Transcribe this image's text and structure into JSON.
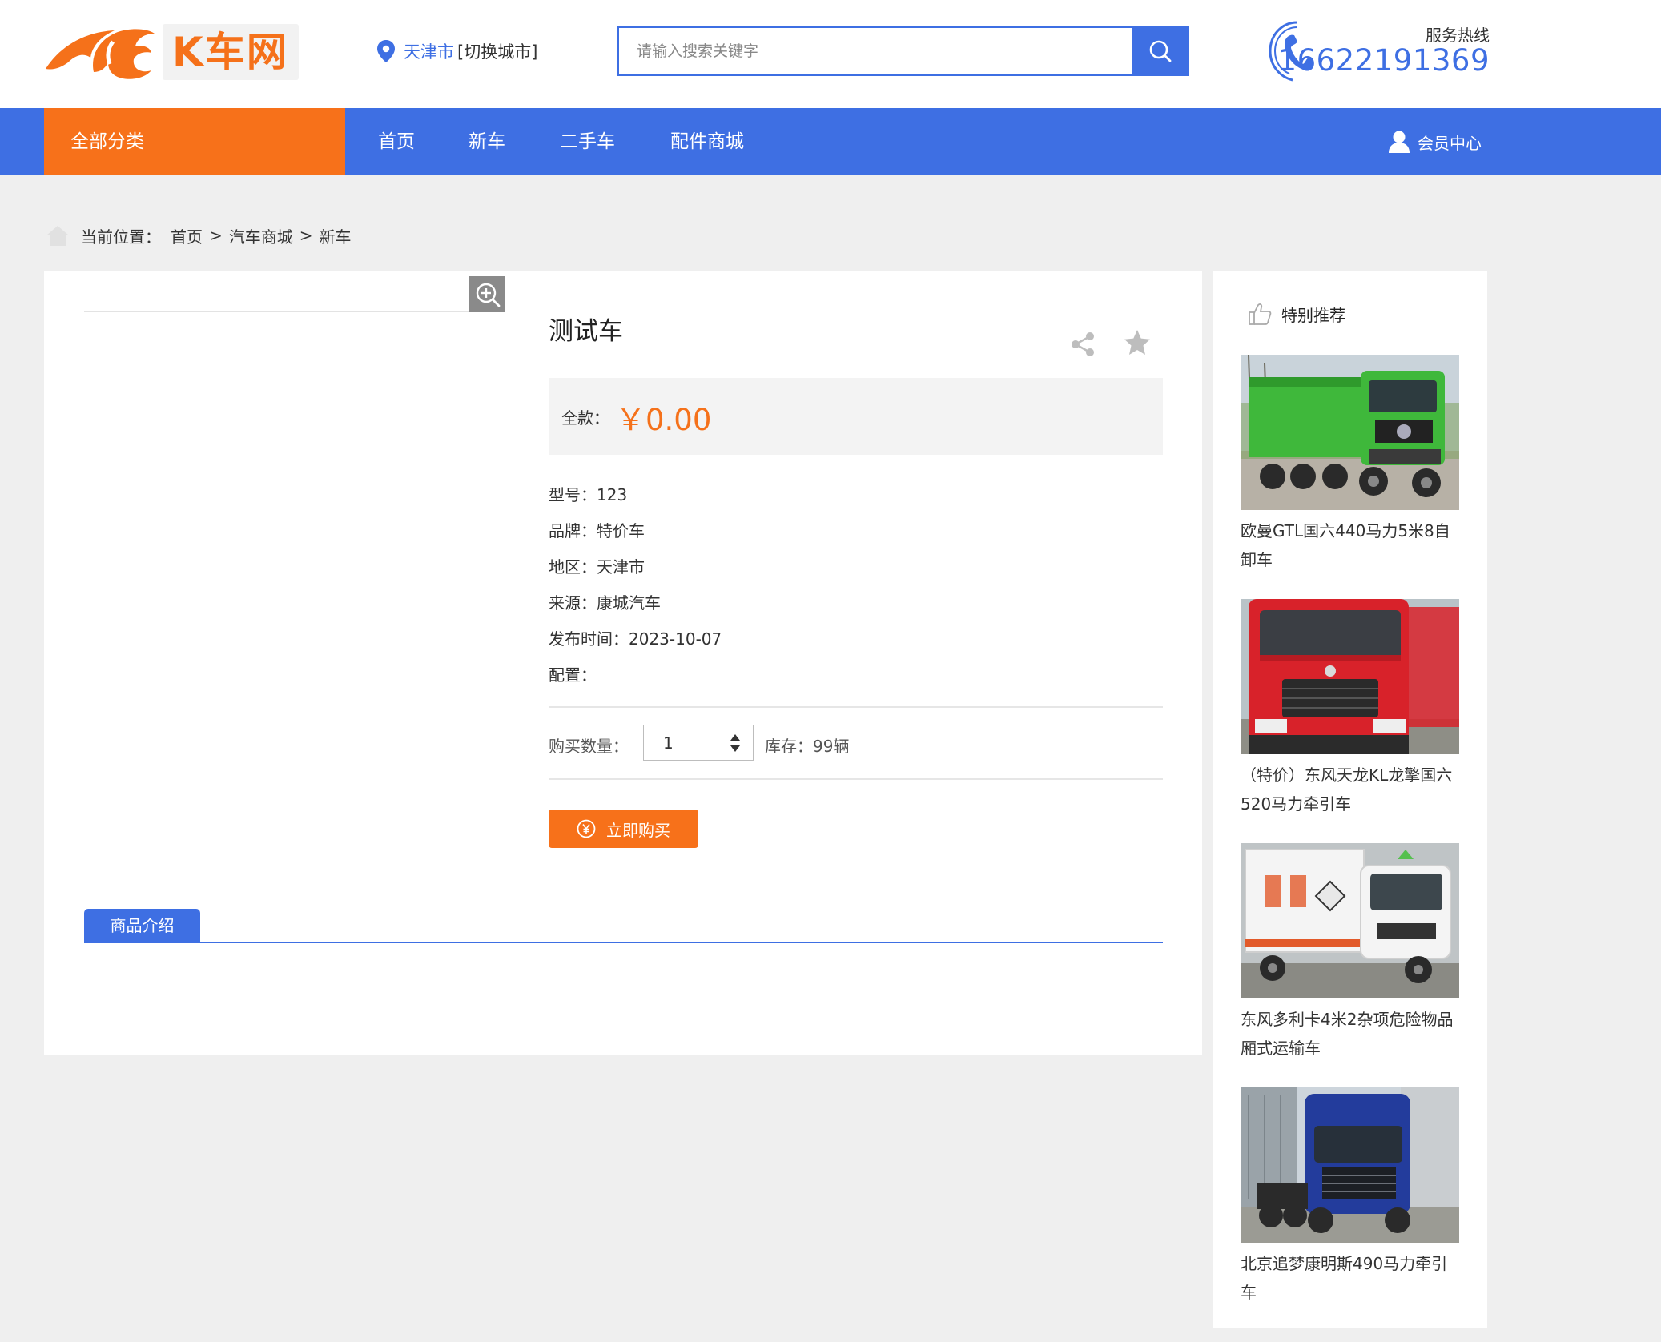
{
  "header": {
    "logo_text": "K车网",
    "location": {
      "city": "天津市",
      "switch_label": "[切换城市]"
    },
    "search": {
      "placeholder": "请输入搜索关键字",
      "value": ""
    },
    "hotline": {
      "label": "服务热线",
      "number": "16622191369"
    }
  },
  "nav": {
    "all_categories": "全部分类",
    "items": [
      "首页",
      "新车",
      "二手车",
      "配件商城"
    ],
    "member_center": "会员中心"
  },
  "breadcrumb": {
    "prefix": "当前位置：",
    "items": [
      "首页",
      "汽车商城",
      "新车"
    ],
    "separator": ">"
  },
  "product": {
    "title": "测试车",
    "price_label": "全款：",
    "price": "￥0.00",
    "specs": [
      "型号：123",
      "品牌：特价车",
      "地区：天津市",
      "来源：康城汽车",
      "发布时间：2023-10-07",
      "配置："
    ],
    "quantity_label": "购买数量：",
    "quantity": "1",
    "stock": "库存：99辆",
    "buy_label": "立即购买",
    "intro_tab": "商品介绍"
  },
  "sidebar": {
    "title": "特别推荐",
    "items": [
      {
        "title": "欧曼GTL国六440马力5米8自卸车",
        "color": "#3fb83b"
      },
      {
        "title": "（特价）东风天龙KL龙擎国六520马力牵引车",
        "color": "#d8222a"
      },
      {
        "title": "东风多利卡4米2杂项危险物品厢式运输车",
        "color": "#f4f4f4"
      },
      {
        "title": "北京追梦康明斯490马力牵引车",
        "color": "#233c9c"
      }
    ]
  },
  "colors": {
    "accent_blue": "#3e6fe3",
    "accent_orange": "#f7711a"
  }
}
